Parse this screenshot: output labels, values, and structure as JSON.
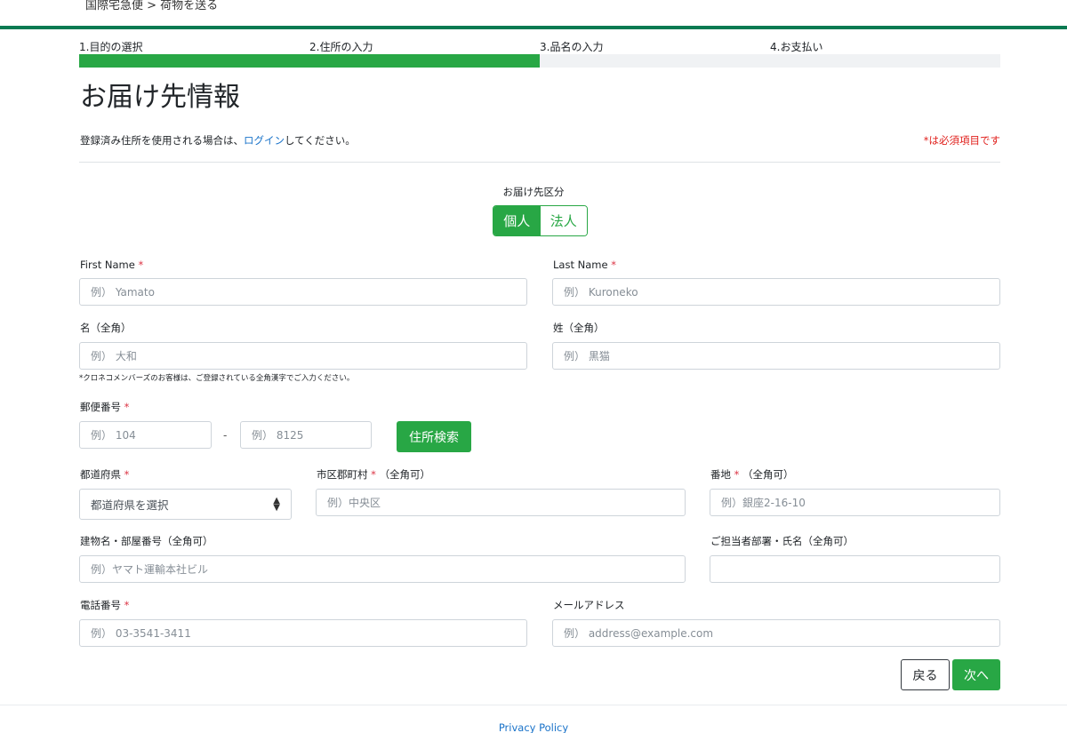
{
  "breadcrumb": "国際宅急便 > 荷物を送る",
  "steps": [
    {
      "label": "1.目的の選択"
    },
    {
      "label": "2.住所の入力"
    },
    {
      "label": "3.品名の入力"
    },
    {
      "label": "4.お支払い"
    }
  ],
  "progress": {
    "completed_fraction": 0.5,
    "fill_color": "#28a745"
  },
  "page_title": "お届け先情報",
  "login_note": {
    "before": "登録済み住所を使用される場合は、",
    "link": "ログイン",
    "after": "してください。"
  },
  "required_note": "*は必須項目です",
  "recipient_type": {
    "label": "お届け先区分",
    "options": [
      "個人",
      "法人"
    ],
    "selected": "個人"
  },
  "form": {
    "first_name": {
      "label": "First Name",
      "required_mark": "*",
      "placeholder": "例） Yamato"
    },
    "last_name": {
      "label": "Last Name",
      "required_mark": "*",
      "placeholder": "例） Kuroneko"
    },
    "given_name_kanji": {
      "label": "名（全角）",
      "placeholder": "例） 大和"
    },
    "family_name_kanji": {
      "label": "姓（全角）",
      "placeholder": "例） 黒猫"
    },
    "kanji_hint": "*クロネコメンバーズのお客様は、ご登録されている全角漢字でご入力ください。",
    "postal_code": {
      "label": "郵便番号",
      "required_mark": "*",
      "placeholder1": "例） 104",
      "separator": "-",
      "placeholder2": "例） 8125",
      "search_button": "住所検索"
    },
    "prefecture": {
      "label": "都道府県",
      "required_mark": "*",
      "value": "都道府県を選択"
    },
    "city": {
      "label": "市区郡町村",
      "required_mark": "*",
      "suffix": "（全角可）",
      "placeholder": "例）中央区"
    },
    "street": {
      "label": "番地",
      "required_mark": "*",
      "suffix": "（全角可）",
      "placeholder": "例）銀座2-16-10"
    },
    "building": {
      "label": "建物名・部屋番号（全角可）",
      "placeholder": "例）ヤマト運輸本社ビル"
    },
    "contact_person": {
      "label": "ご担当者部署・氏名（全角可）",
      "placeholder": ""
    },
    "phone": {
      "label": "電話番号",
      "required_mark": "*",
      "placeholder": "例） 03-3541-3411"
    },
    "email": {
      "label": "メールアドレス",
      "placeholder": "例） address@example.com"
    }
  },
  "buttons": {
    "back": "戻る",
    "next": "次へ"
  },
  "footer": {
    "privacy": "Privacy Policy"
  },
  "colors": {
    "brand_green": "#28a745",
    "top_bar": "#0a7a52",
    "required_red": "#dc3545",
    "link_blue": "#1a73c9"
  }
}
